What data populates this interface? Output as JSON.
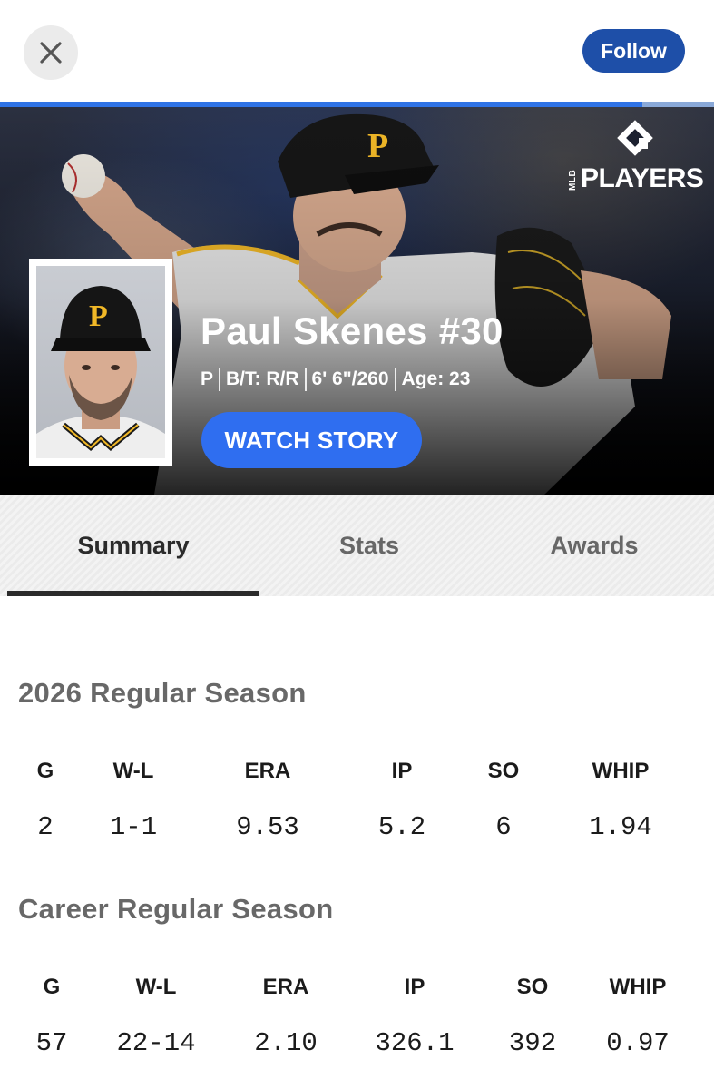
{
  "topbar": {
    "close_icon": "close-icon",
    "follow_label": "Follow",
    "story_progress": 0.9
  },
  "hero": {
    "brand_logo_text": "PLAYERS",
    "brand_logo_small": "MLB",
    "player_name": "Paul Skenes #30",
    "info": [
      "P",
      "B/T: R/R",
      "6' 6\"/260",
      "Age: 23"
    ],
    "watch_label": "WATCH STORY",
    "accent_color": "#2f6ef0",
    "team_cap_letter": "P"
  },
  "tabs": [
    "Summary",
    "Stats",
    "Awards"
  ],
  "active_tab": "Summary",
  "sections": [
    {
      "title": "2026 Regular Season",
      "headers": [
        "G",
        "W-L",
        "ERA",
        "IP",
        "SO",
        "WHIP"
      ],
      "values": [
        "2",
        "1-1",
        "9.53",
        "5.2",
        "6",
        "1.94"
      ]
    },
    {
      "title": "Career Regular Season",
      "headers": [
        "G",
        "W-L",
        "ERA",
        "IP",
        "SO",
        "WHIP"
      ],
      "values": [
        "57",
        "22-14",
        "2.10",
        "326.1",
        "392",
        "0.97"
      ]
    }
  ]
}
